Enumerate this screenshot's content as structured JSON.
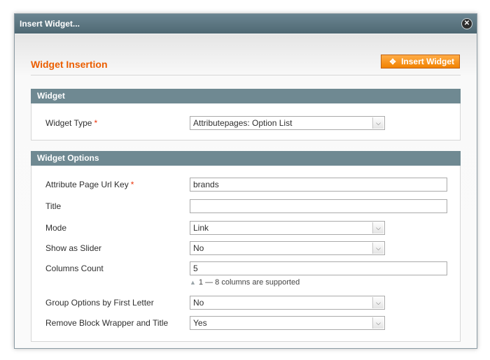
{
  "window": {
    "title": "Insert Widget...",
    "close_icon": "close-icon"
  },
  "header": {
    "title": "Widget Insertion",
    "insert_button_label": "Insert Widget",
    "insert_icon": "widget-icon",
    "accent": "#eb5e00"
  },
  "widget_section": {
    "heading": "Widget",
    "widget_type_label": "Widget Type",
    "required_mark": "*",
    "widget_type_value": "Attributepages: Option List"
  },
  "options_section": {
    "heading": "Widget Options",
    "required_mark": "*",
    "url_key_label": "Attribute Page Url Key",
    "url_key_value": "brands",
    "title_label": "Title",
    "title_value": "",
    "mode_label": "Mode",
    "mode_value": "Link",
    "slider_label": "Show as Slider",
    "slider_value": "No",
    "columns_label": "Columns Count",
    "columns_value": "5",
    "columns_note": "1 — 8 columns are supported",
    "group_label": "Group Options by First Letter",
    "group_value": "No",
    "wrapper_label": "Remove Block Wrapper and Title",
    "wrapper_value": "Yes"
  }
}
